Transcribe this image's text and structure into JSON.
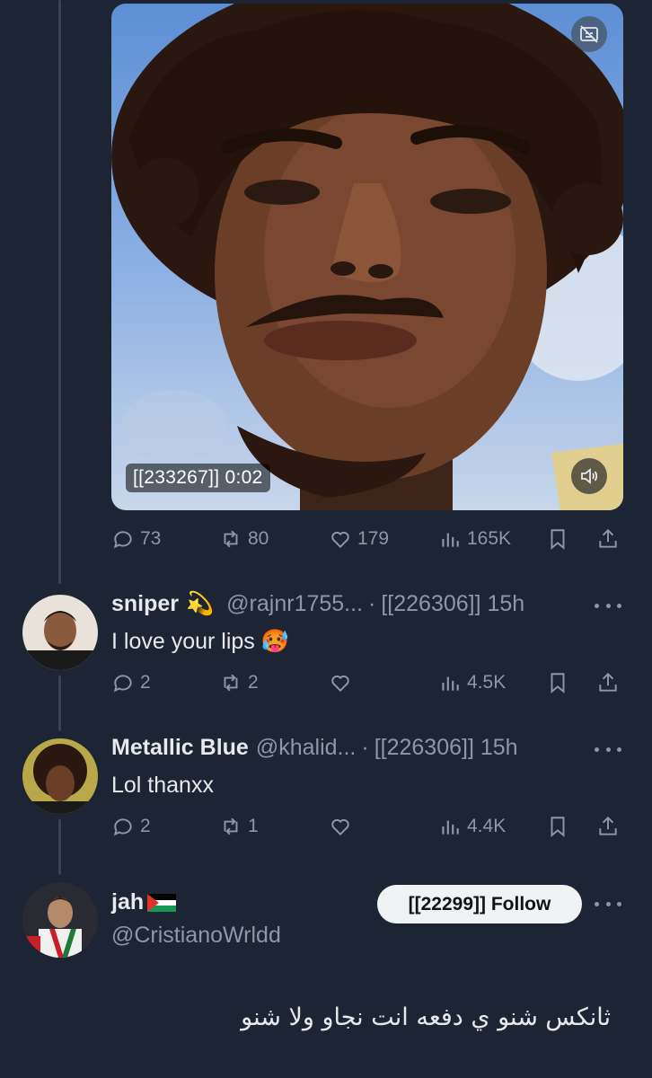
{
  "video": {
    "time_badge": "[[233267]] 0:02",
    "captions_icon": "captions-off-icon",
    "sound_icon": "speaker-icon"
  },
  "main_actions": {
    "replies": "73",
    "reposts": "80",
    "likes": "179",
    "views": "165K"
  },
  "replies": [
    {
      "display_name": "sniper",
      "emoji_after_name": "💫",
      "handle": "@rajnr1755...",
      "separator": "·",
      "time": "[[226306]] 15h",
      "text": "I love your lips",
      "text_emoji": "🥵",
      "actions": {
        "replies": "2",
        "reposts": "2",
        "likes": "",
        "views": "4.5K"
      }
    },
    {
      "display_name": "Metallic Blue",
      "handle": "@khalid...",
      "separator": "·",
      "time": "[[226306]] 15h",
      "text": "Lol thanxx",
      "actions": {
        "replies": "2",
        "reposts": "1",
        "likes": "",
        "views": "4.4K"
      }
    }
  ],
  "suggested": {
    "display_name": "jah",
    "flag": "palestine-flag",
    "handle": "@CristianoWrldd",
    "follow_label": "[[22299]] Follow",
    "post_text": "ثانكس شنو ي دفعه انت نجاو ولا شنو"
  },
  "colors": {
    "background": "#1d2433",
    "muted_text": "#8b98a5",
    "thread_line": "#3b4150",
    "follow_bg": "#eff3f4"
  }
}
